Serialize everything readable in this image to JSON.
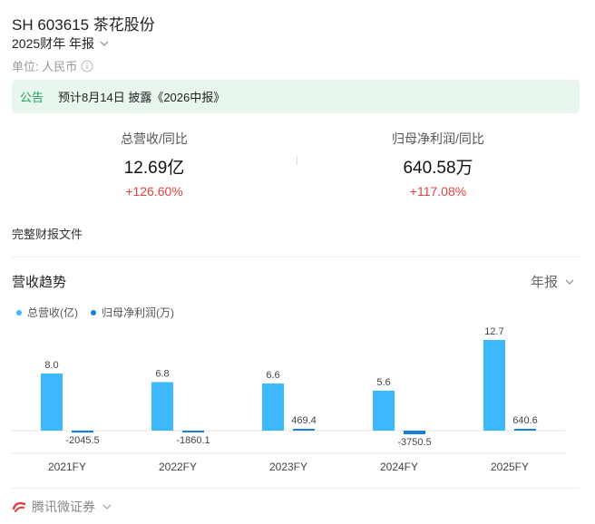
{
  "header": {
    "title": "SH 603615 茶花股份",
    "period": "2025财年 年报",
    "unit": "单位: 人民币"
  },
  "notice": {
    "tag": "公告",
    "text": "预计8月14日 披露《2026中报》"
  },
  "metrics": [
    {
      "label": "总营收/同比",
      "value": "12.69亿",
      "change": "+126.60%"
    },
    {
      "label": "归母净利润/同比",
      "value": "640.58万",
      "change": "+117.08%"
    }
  ],
  "report_link": "完整财报文件",
  "section": {
    "title": "营收趋势",
    "period": "年报"
  },
  "legend": [
    {
      "label": "总营收(亿)",
      "color": "#3db8ff"
    },
    {
      "label": "归母净利润(万)",
      "color": "#1a7fd6"
    }
  ],
  "chart_data": {
    "type": "bar",
    "categories": [
      "2021FY",
      "2022FY",
      "2023FY",
      "2024FY",
      "2025FY"
    ],
    "series": [
      {
        "name": "总营收(亿)",
        "values": [
          8.0,
          6.8,
          6.6,
          5.6,
          12.7
        ],
        "labels": [
          "8.0",
          "6.8",
          "6.6",
          "5.6",
          "12.7"
        ],
        "color": "#3db8ff"
      },
      {
        "name": "归母净利润(万)",
        "values": [
          -2045.5,
          -1860.1,
          469.4,
          -3750.5,
          640.6
        ],
        "labels": [
          "-2045.5",
          "-1860.1",
          "469.4",
          "-3750.5",
          "640.6"
        ],
        "color": "#1a7fd6"
      }
    ]
  },
  "footer": {
    "brand": "腾讯微证券"
  }
}
